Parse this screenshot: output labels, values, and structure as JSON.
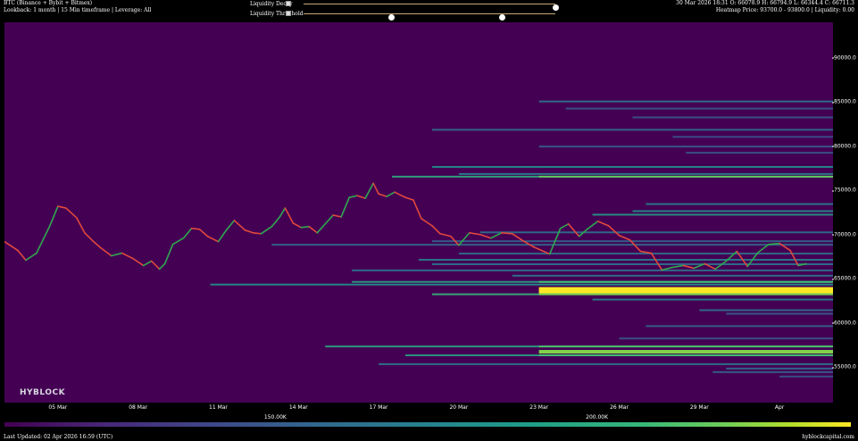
{
  "header": {
    "left_line1": "BTC (Binance + Bybit + Bitmex)",
    "left_line2": "Lookback: 1 month | 15 Min timeframe | Leverage: All",
    "right_line1": "30 Mar 2026 18:31 O: 66078.9 H: 66794.9 L: 66344.4 C: 66711.3",
    "right_line2": "Heatmap Price: 93700.0 - 93800.0 | Liquidity: 0.00"
  },
  "controls": {
    "decay_label": "Liquidity Decay",
    "threshold_label": "Liquidity Threshold",
    "decay_value": 1.0,
    "threshold_range": [
      0.35,
      0.79
    ]
  },
  "watermark": "HYBLOCK",
  "colorbar": {
    "labels": [
      "150.00K",
      "200.00K"
    ],
    "label_positions": [
      0.32,
      0.7
    ]
  },
  "footer": {
    "left": "Last Updated: 02 Apr 2026 16:59 (UTC)",
    "right": "hyblockcapital.com"
  },
  "colors": {
    "background": "#440154",
    "up": "#2fa84f",
    "down": "#e0483c"
  },
  "chart_data": {
    "type": "heatmap",
    "title": "",
    "xlabel": "",
    "ylabel": "",
    "ylim": [
      51000,
      94000
    ],
    "xlim": [
      0,
      31
    ],
    "yticks": [
      {
        "label": "90000.0",
        "value": 90000
      },
      {
        "label": "85000.0",
        "value": 85000
      },
      {
        "label": "80000.0",
        "value": 80000
      },
      {
        "label": "75000.0",
        "value": 75000
      },
      {
        "label": "70000.0",
        "value": 70000
      },
      {
        "label": "65000.0",
        "value": 65000
      },
      {
        "label": "60000.0",
        "value": 60000
      },
      {
        "label": "55000.0",
        "value": 55000
      }
    ],
    "xticks": [
      {
        "label": "05 Mar",
        "value": 2
      },
      {
        "label": "08 Mar",
        "value": 5
      },
      {
        "label": "11 Mar",
        "value": 8
      },
      {
        "label": "14 Mar",
        "value": 11
      },
      {
        "label": "17 Mar",
        "value": 14
      },
      {
        "label": "20 Mar",
        "value": 17
      },
      {
        "label": "23 Mar",
        "value": 20
      },
      {
        "label": "26 Mar",
        "value": 23
      },
      {
        "label": "29 Mar",
        "value": 26
      },
      {
        "label": "Apr",
        "value": 29
      }
    ],
    "price_series": {
      "name": "BTC",
      "x": [
        0,
        0.5,
        0.8,
        1.2,
        1.7,
        2.0,
        2.3,
        2.7,
        3.0,
        3.3,
        3.6,
        4.0,
        4.4,
        4.8,
        5.2,
        5.5,
        5.8,
        6.0,
        6.3,
        6.7,
        7.0,
        7.3,
        7.6,
        8.0,
        8.3,
        8.6,
        9.0,
        9.3,
        9.6,
        10.0,
        10.3,
        10.5,
        10.8,
        11.1,
        11.4,
        11.7,
        12.0,
        12.3,
        12.6,
        12.9,
        13.2,
        13.5,
        13.8,
        14.0,
        14.3,
        14.6,
        15.0,
        15.3,
        15.6,
        16.0,
        16.3,
        16.7,
        17.0,
        17.4,
        17.8,
        18.2,
        18.6,
        19.0,
        19.4,
        19.8,
        20.1,
        20.4,
        20.8,
        21.1,
        21.5,
        21.8,
        22.2,
        22.6,
        23.0,
        23.4,
        23.8,
        24.2,
        24.6,
        25.0,
        25.4,
        25.8,
        26.2,
        26.6,
        27.0,
        27.4,
        27.8,
        28.2,
        28.6,
        29.0,
        29.4,
        29.7,
        30.0
      ],
      "y": [
        69200,
        68200,
        67100,
        67900,
        71000,
        73200,
        73000,
        71900,
        70200,
        69300,
        68500,
        67600,
        67900,
        67300,
        66500,
        67000,
        66100,
        66700,
        68900,
        69600,
        70700,
        70600,
        69800,
        69200,
        70500,
        71600,
        70500,
        70200,
        70100,
        70900,
        72000,
        73000,
        71300,
        70800,
        70900,
        70200,
        71200,
        72200,
        72000,
        74200,
        74400,
        74100,
        75800,
        74600,
        74300,
        74800,
        74200,
        73900,
        71800,
        71000,
        70100,
        69800,
        68800,
        70200,
        70000,
        69600,
        70200,
        70100,
        69300,
        68600,
        68200,
        67800,
        70700,
        71200,
        69800,
        70600,
        71500,
        71000,
        69900,
        69400,
        68100,
        67900,
        66000,
        66300,
        66500,
        66200,
        66700,
        66100,
        67000,
        68100,
        66400,
        68000,
        68900,
        69000,
        68200,
        66500,
        66700
      ]
    },
    "liquidity_levels": [
      {
        "price": 85000,
        "x_start": 20.0,
        "intensity": 0.3
      },
      {
        "price": 84200,
        "x_start": 21.0,
        "intensity": 0.22
      },
      {
        "price": 83200,
        "x_start": 23.5,
        "intensity": 0.22
      },
      {
        "price": 81800,
        "x_start": 16.0,
        "intensity": 0.28
      },
      {
        "price": 81000,
        "x_start": 25.0,
        "intensity": 0.2
      },
      {
        "price": 79900,
        "x_start": 20.0,
        "intensity": 0.24
      },
      {
        "price": 79200,
        "x_start": 25.5,
        "intensity": 0.22
      },
      {
        "price": 77600,
        "x_start": 16.0,
        "intensity": 0.4
      },
      {
        "price": 76800,
        "x_start": 17.0,
        "intensity": 0.36
      },
      {
        "price": 76500,
        "x_start": 14.5,
        "intensity": 0.55
      },
      {
        "price": 73400,
        "x_start": 24.0,
        "intensity": 0.35
      },
      {
        "price": 72600,
        "x_start": 23.5,
        "intensity": 0.4
      },
      {
        "price": 72200,
        "x_start": 22.0,
        "intensity": 0.45
      },
      {
        "price": 70200,
        "x_start": 17.8,
        "intensity": 0.3
      },
      {
        "price": 69200,
        "x_start": 16.0,
        "intensity": 0.26
      },
      {
        "price": 68800,
        "x_start": 10.0,
        "intensity": 0.28
      },
      {
        "price": 67800,
        "x_start": 17.0,
        "intensity": 0.3
      },
      {
        "price": 67100,
        "x_start": 15.5,
        "intensity": 0.34
      },
      {
        "price": 66600,
        "x_start": 16.0,
        "intensity": 0.32
      },
      {
        "price": 65900,
        "x_start": 13.0,
        "intensity": 0.3
      },
      {
        "price": 65300,
        "x_start": 19.0,
        "intensity": 0.32
      },
      {
        "price": 64600,
        "x_start": 13.0,
        "intensity": 0.48
      },
      {
        "price": 64300,
        "x_start": 7.7,
        "intensity": 0.4
      },
      {
        "price": 63900,
        "x_start": 20.0,
        "intensity": 0.85
      },
      {
        "price": 63600,
        "x_start": 20.0,
        "intensity": 1.0
      },
      {
        "price": 63200,
        "x_start": 16.0,
        "intensity": 0.6
      },
      {
        "price": 62600,
        "x_start": 22.0,
        "intensity": 0.34
      },
      {
        "price": 61400,
        "x_start": 26.0,
        "intensity": 0.3
      },
      {
        "price": 61000,
        "x_start": 27.0,
        "intensity": 0.24
      },
      {
        "price": 59600,
        "x_start": 24.0,
        "intensity": 0.26
      },
      {
        "price": 58200,
        "x_start": 23.0,
        "intensity": 0.22
      },
      {
        "price": 57300,
        "x_start": 12.0,
        "intensity": 0.5
      },
      {
        "price": 56800,
        "x_start": 20.0,
        "intensity": 0.62
      },
      {
        "price": 56300,
        "x_start": 15.0,
        "intensity": 0.48
      },
      {
        "price": 55300,
        "x_start": 14.0,
        "intensity": 0.32
      },
      {
        "price": 54800,
        "x_start": 27.0,
        "intensity": 0.28
      },
      {
        "price": 54400,
        "x_start": 26.5,
        "intensity": 0.26
      },
      {
        "price": 53900,
        "x_start": 29.0,
        "intensity": 0.22
      }
    ]
  }
}
